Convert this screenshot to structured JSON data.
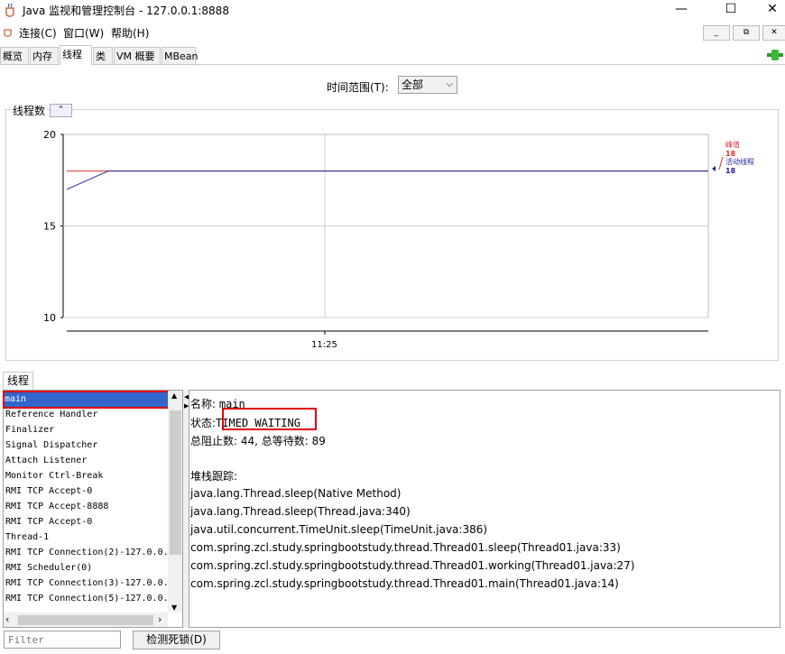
{
  "window": {
    "title": "Java 监视和管理控制台 - 127.0.0.1:8888",
    "controls": [
      "—",
      "☐",
      "✕"
    ]
  },
  "menu": {
    "items": [
      "连接(C)",
      "窗口(W)",
      "帮助(H)"
    ],
    "mdi_controls": [
      "_",
      "⧉",
      "✕"
    ]
  },
  "tabs": [
    {
      "label": "概览"
    },
    {
      "label": "内存"
    },
    {
      "label": "线程",
      "active": true
    },
    {
      "label": "类"
    },
    {
      "label": "VM 概要"
    },
    {
      "label": "MBean"
    }
  ],
  "time_range": {
    "label": "时间范围(T):",
    "value": "全部"
  },
  "chart_panel": {
    "title": "线程数",
    "collapse_symbol": "⌃"
  },
  "chart_data": {
    "type": "line",
    "ylim": [
      10,
      20
    ],
    "y_ticks": [
      "20",
      "15",
      "10"
    ],
    "x_ticks": [
      "11:25"
    ],
    "series": [
      {
        "name": "峰值",
        "current": "18",
        "color": "#e03030",
        "values": [
          18,
          18,
          18
        ]
      },
      {
        "name": "活动线程",
        "current": "18",
        "color": "#2020a0",
        "values": [
          17,
          18,
          18
        ]
      }
    ]
  },
  "threads_panel": {
    "tab_label": "线程",
    "list": [
      "main",
      "Reference Handler",
      "Finalizer",
      "Signal Dispatcher",
      "Attach Listener",
      "Monitor Ctrl-Break",
      "RMI TCP Accept-0",
      "RMI TCP Accept-8888",
      "RMI TCP Accept-0",
      "Thread-1",
      "RMI TCP Connection(2)-127.0.0.",
      "RMI Scheduler(0)",
      "RMI TCP Connection(3)-127.0.0.",
      "RMI TCP Connection(5)-127.0.0."
    ],
    "selected": "main",
    "filter_placeholder": "Filter",
    "detect_button": "检测死锁(D)"
  },
  "details": {
    "name_label": "名称:",
    "name_value": "main",
    "state_label": "状态:",
    "state_value": "TIMED_WAITING",
    "counts": "总阻止数: 44, 总等待数: 89",
    "stack_label": "堆栈跟踪:",
    "stack": [
      "java.lang.Thread.sleep(Native Method)",
      "java.lang.Thread.sleep(Thread.java:340)",
      "java.util.concurrent.TimeUnit.sleep(TimeUnit.java:386)",
      "com.spring.zcl.study.springbootstudy.thread.Thread01.sleep(Thread01.java:33)",
      "com.spring.zcl.study.springbootstudy.thread.Thread01.working(Thread01.java:27)",
      "com.spring.zcl.study.springbootstudy.thread.Thread01.main(Thread01.java:14)"
    ]
  }
}
